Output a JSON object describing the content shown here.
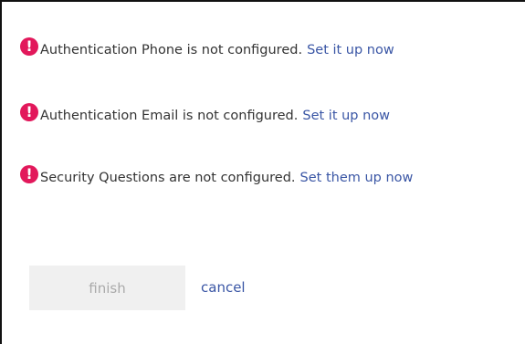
{
  "colors": {
    "alert": "#e2185b",
    "link": "#3a56a5",
    "text": "#333333",
    "disabled_button_bg": "#f0f0f0",
    "disabled_button_text": "#aaaaaa"
  },
  "notices": [
    {
      "icon": "alert-exclamation-icon",
      "glyph": "!",
      "message": "Authentication Phone is not configured.",
      "link": "Set it up now"
    },
    {
      "icon": "alert-exclamation-icon",
      "glyph": "!",
      "message": "Authentication Email is not configured.",
      "link": "Set it up now"
    },
    {
      "icon": "alert-exclamation-icon",
      "glyph": "!",
      "message": "Security Questions are not configured.",
      "link": "Set them up now"
    }
  ],
  "actions": {
    "finish_label": "finish",
    "finish_disabled": true,
    "cancel_label": "cancel"
  }
}
